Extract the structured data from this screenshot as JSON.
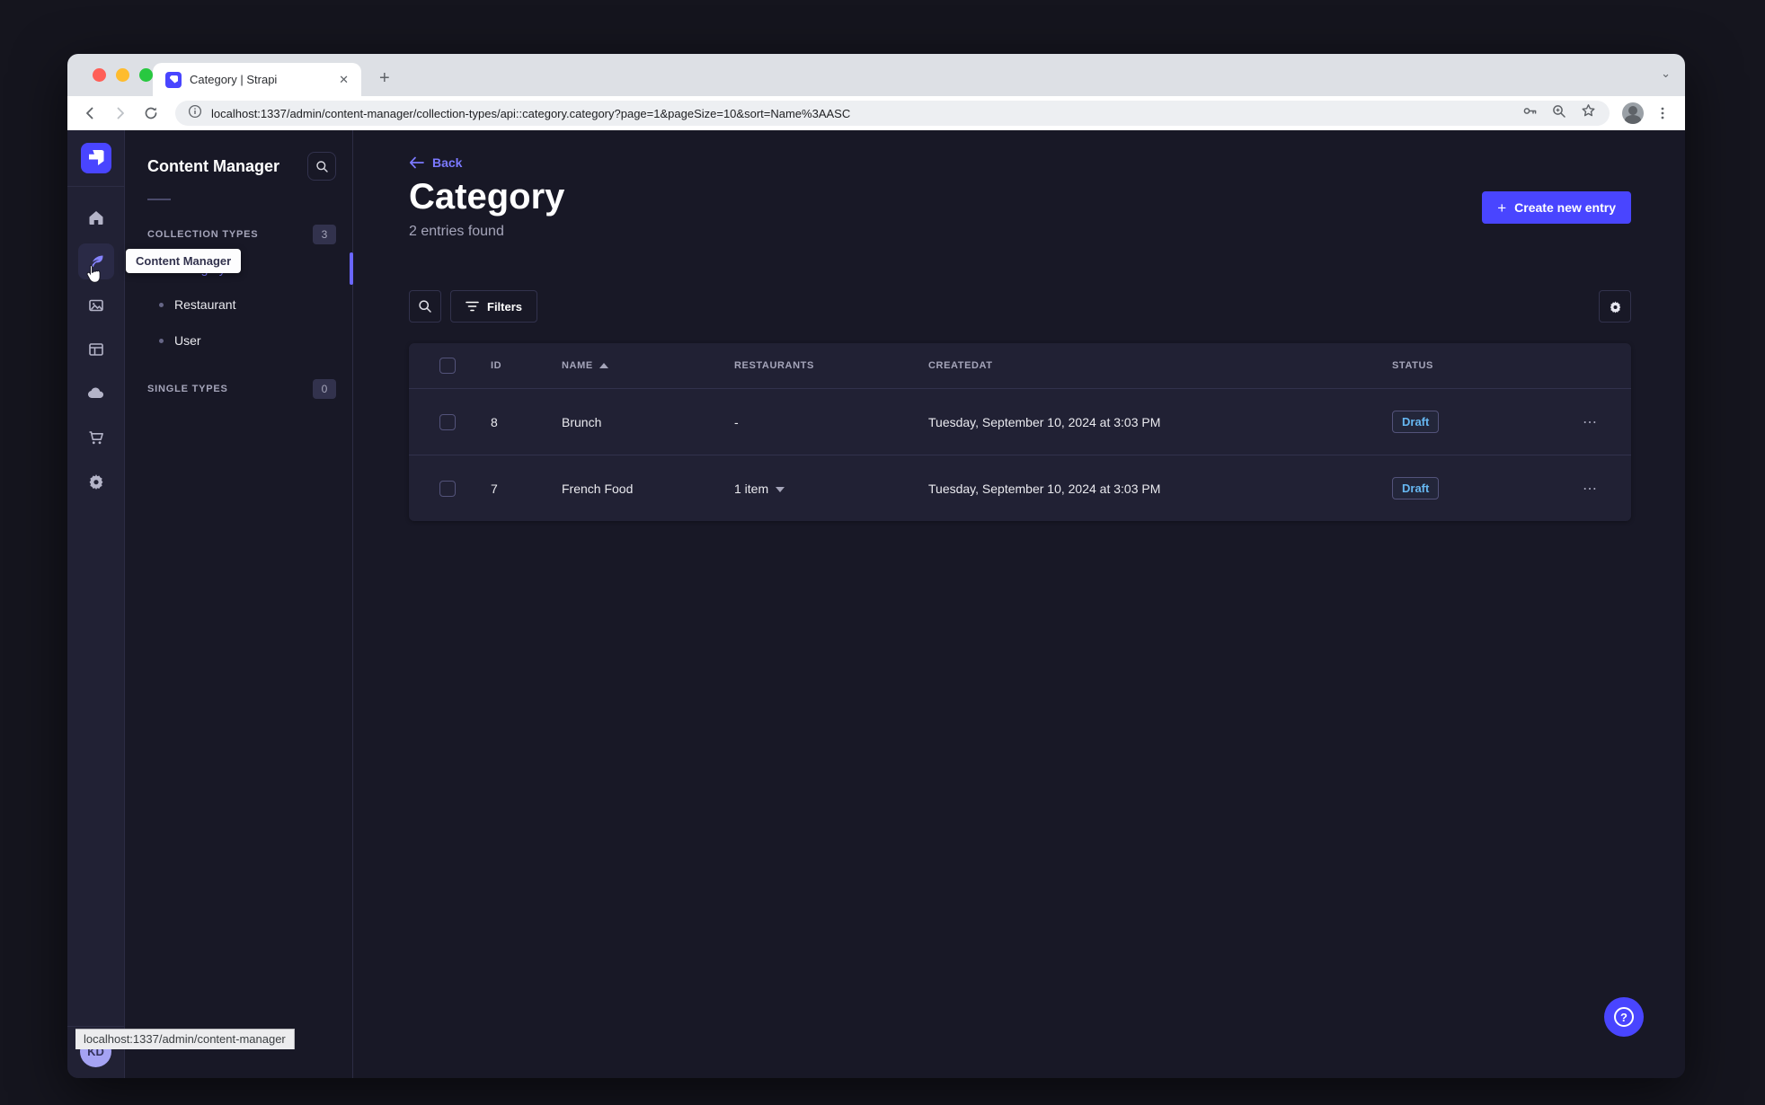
{
  "browser": {
    "tab_title": "Category | Strapi",
    "tab_close": "✕",
    "new_tab_label": "+",
    "strip_chevron": "⌄",
    "url": "localhost:1337/admin/content-manager/collection-types/api::category.category?page=1&pageSize=10&sort=Name%3AASC",
    "status_bar_link": "localhost:1337/admin/content-manager"
  },
  "main_nav": {
    "tooltip": "Content Manager",
    "avatar_initials": "KD"
  },
  "sub_nav": {
    "title": "Content Manager",
    "collection_types": {
      "label": "COLLECTION TYPES",
      "badge": "3",
      "items": [
        {
          "label": "Category",
          "active": true
        },
        {
          "label": "Restaurant",
          "active": false
        },
        {
          "label": "User",
          "active": false
        }
      ]
    },
    "single_types": {
      "label": "SINGLE TYPES",
      "badge": "0"
    }
  },
  "content": {
    "back_label": "Back",
    "title": "Category",
    "subtitle": "2 entries found",
    "create_button_label": "Create new entry",
    "filters_button_label": "Filters"
  },
  "table": {
    "headers": {
      "id": "ID",
      "name": "NAME",
      "restaurants": "RESTAURANTS",
      "createdat": "CREATEDAT",
      "status": "STATUS"
    },
    "rows": [
      {
        "id": "8",
        "name": "Brunch",
        "restaurants": "-",
        "createdat": "Tuesday, September 10, 2024 at 3:03 PM",
        "status": "Draft",
        "actions": "⋯"
      },
      {
        "id": "7",
        "name": "French Food",
        "restaurants": "1 item",
        "createdat": "Tuesday, September 10, 2024 at 3:03 PM",
        "status": "Draft",
        "actions": "⋯"
      }
    ]
  },
  "help": {
    "glyph": "?"
  },
  "colors": {
    "accent": "#4945ff",
    "accent_light": "#7b79ff",
    "draft_text": "#66b7f1",
    "panel": "#212134",
    "background": "#181826"
  }
}
